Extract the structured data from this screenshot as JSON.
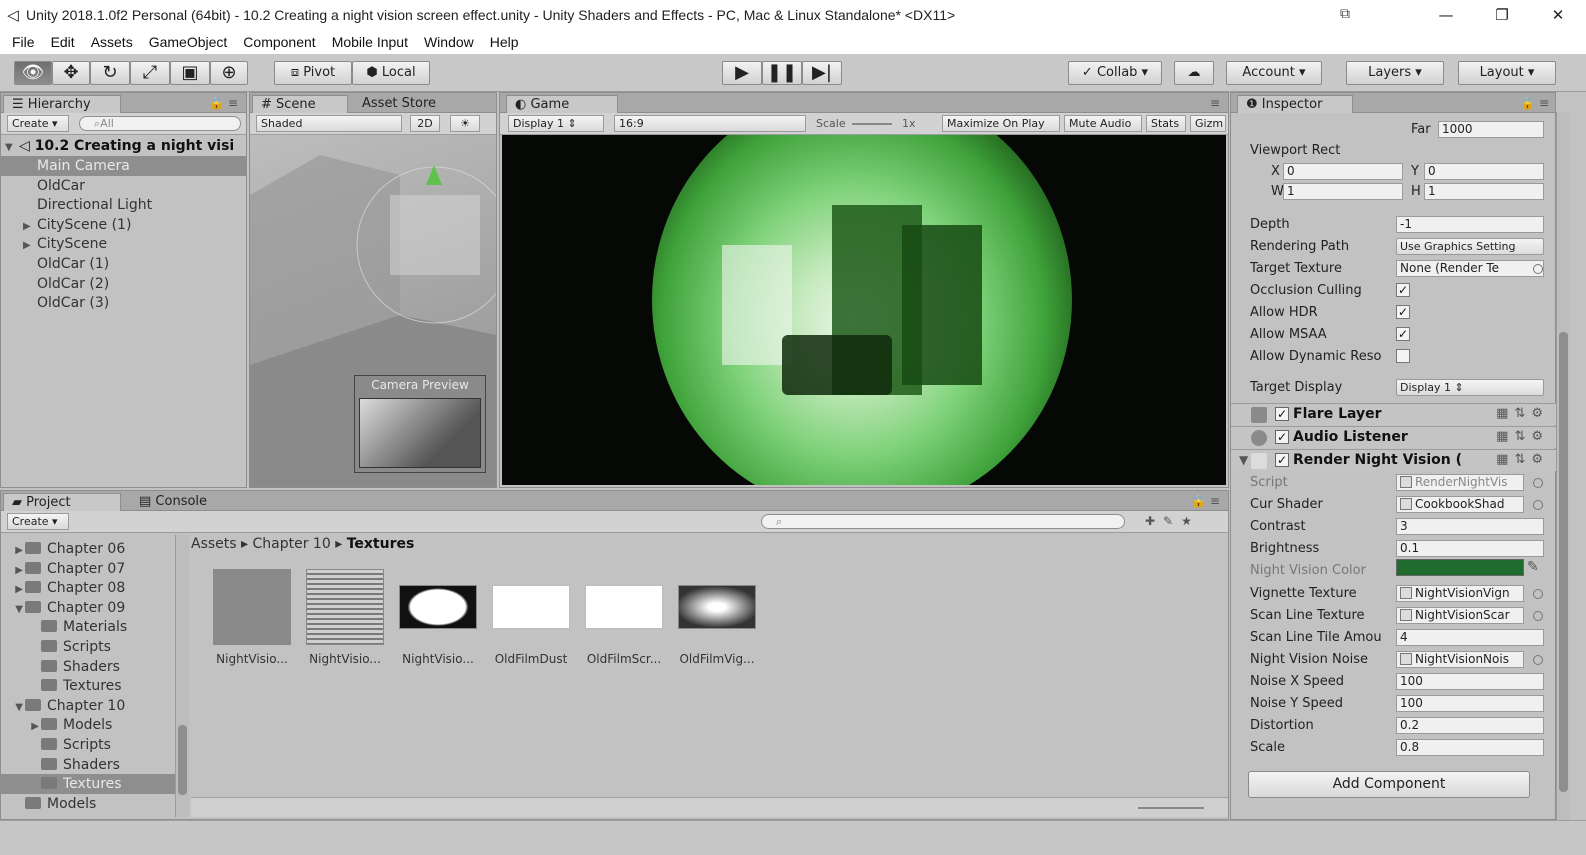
{
  "window": {
    "title": "Unity 2018.1.0f2 Personal (64bit) - 10.2 Creating a night vision screen effect.unity - Unity Shaders and Effects - PC, Mac & Linux Standalone* <DX11>",
    "minimize": "—",
    "maximize": "❐",
    "close": "✕"
  },
  "menu": [
    "File",
    "Edit",
    "Assets",
    "GameObject",
    "Component",
    "Mobile Input",
    "Window",
    "Help"
  ],
  "toolbar": {
    "pivot": "Pivot",
    "local": "Local",
    "collab": "Collab",
    "account": "Account",
    "layers": "Layers",
    "layout": "Layout"
  },
  "hierarchy": {
    "tab": "Hierarchy",
    "create": "Create",
    "search_placeholder": "All",
    "scene_root": "10.2 Creating a night visi",
    "items": [
      {
        "label": "Main Camera",
        "selected": true,
        "expandable": false
      },
      {
        "label": "OldCar",
        "selected": false,
        "expandable": false
      },
      {
        "label": "Directional Light",
        "selected": false,
        "expandable": false
      },
      {
        "label": "CityScene (1)",
        "selected": false,
        "expandable": true
      },
      {
        "label": "CityScene",
        "selected": false,
        "expandable": true
      },
      {
        "label": "OldCar (1)",
        "selected": false,
        "expandable": false
      },
      {
        "label": "OldCar (2)",
        "selected": false,
        "expandable": false
      },
      {
        "label": "OldCar (3)",
        "selected": false,
        "expandable": false
      }
    ]
  },
  "scene": {
    "tab": "Scene",
    "tab2": "Asset Store",
    "shading": "Shaded",
    "mode2d": "2D",
    "camera_preview": "Camera Preview"
  },
  "game": {
    "tab": "Game",
    "display": "Display 1",
    "aspect": "16:9",
    "scale_label": "Scale",
    "scale_value": "1x",
    "maximize": "Maximize On Play",
    "mute": "Mute Audio",
    "stats": "Stats",
    "gizmos": "Gizm"
  },
  "inspector": {
    "tab": "Inspector",
    "far_label": "Far",
    "far_value": "1000",
    "viewport_rect": "Viewport Rect",
    "x_label": "X",
    "x_value": "0",
    "y_label": "Y",
    "y_value": "0",
    "w_label": "W",
    "w_value": "1",
    "h_label": "H",
    "h_value": "1",
    "props": [
      {
        "label": "Depth",
        "value": "-1",
        "kind": "field"
      },
      {
        "label": "Rendering Path",
        "value": "Use Graphics Setting",
        "kind": "dropdown"
      },
      {
        "label": "Target Texture",
        "value": "None (Render Te",
        "kind": "object"
      },
      {
        "label": "Occlusion Culling",
        "value": "✓",
        "kind": "check"
      },
      {
        "label": "Allow HDR",
        "value": "✓",
        "kind": "check"
      },
      {
        "label": "Allow MSAA",
        "value": "✓",
        "kind": "check"
      },
      {
        "label": "Allow Dynamic Reso",
        "value": "",
        "kind": "check"
      }
    ],
    "target_display_label": "Target Display",
    "target_display_value": "Display 1",
    "flare_layer": "Flare Layer",
    "audio_listener": "Audio Listener",
    "render_night_vision": "Render Night Vision (",
    "nv_props": [
      {
        "label": "Script",
        "value": "RenderNightVis",
        "dim": true
      },
      {
        "label": "Cur Shader",
        "value": "CookbookShad",
        "dim": false
      },
      {
        "label": "Contrast",
        "value": "3",
        "dim": false
      },
      {
        "label": "Brightness",
        "value": "0.1",
        "dim": false
      },
      {
        "label": "Night Vision Color",
        "value": "",
        "dim": true
      },
      {
        "label": "Vignette Texture",
        "value": "NightVisionVign",
        "dim": false
      },
      {
        "label": "Scan Line Texture",
        "value": "NightVisionScar",
        "dim": false
      },
      {
        "label": "Scan Line Tile Amou",
        "value": "4",
        "dim": false
      },
      {
        "label": "Night Vision Noise",
        "value": "NightVisionNois",
        "dim": false
      },
      {
        "label": "Noise X Speed",
        "value": "100",
        "dim": false
      },
      {
        "label": "Noise Y Speed",
        "value": "100",
        "dim": false
      },
      {
        "label": "Distortion",
        "value": "0.2",
        "dim": false
      },
      {
        "label": "Scale",
        "value": "0.8",
        "dim": false
      }
    ],
    "night_vision_color": "#1f6a2d",
    "add_component": "Add Component"
  },
  "project": {
    "tab": "Project",
    "tab2": "Console",
    "create": "Create",
    "tree": [
      {
        "label": "Chapter 06",
        "indent": 1,
        "arrow": "▶",
        "selected": false
      },
      {
        "label": "Chapter 07",
        "indent": 1,
        "arrow": "▶",
        "selected": false
      },
      {
        "label": "Chapter 08",
        "indent": 1,
        "arrow": "▶",
        "selected": false
      },
      {
        "label": "Chapter 09",
        "indent": 1,
        "arrow": "▼",
        "selected": false
      },
      {
        "label": "Materials",
        "indent": 2,
        "arrow": "",
        "selected": false
      },
      {
        "label": "Scripts",
        "indent": 2,
        "arrow": "",
        "selected": false
      },
      {
        "label": "Shaders",
        "indent": 2,
        "arrow": "",
        "selected": false
      },
      {
        "label": "Textures",
        "indent": 2,
        "arrow": "",
        "selected": false
      },
      {
        "label": "Chapter 10",
        "indent": 1,
        "arrow": "▼",
        "selected": false
      },
      {
        "label": "Models",
        "indent": 2,
        "arrow": "▶",
        "selected": false
      },
      {
        "label": "Scripts",
        "indent": 2,
        "arrow": "",
        "selected": false
      },
      {
        "label": "Shaders",
        "indent": 2,
        "arrow": "",
        "selected": false
      },
      {
        "label": "Textures",
        "indent": 2,
        "arrow": "",
        "selected": true
      },
      {
        "label": "Models",
        "indent": 1,
        "arrow": "",
        "selected": false
      }
    ],
    "breadcrumb": [
      "Assets",
      "Chapter 10",
      "Textures"
    ],
    "assets": [
      {
        "name": "NightVisio...",
        "thumb": "gray"
      },
      {
        "name": "NightVisio...",
        "thumb": "lines"
      },
      {
        "name": "NightVisio...",
        "thumb": "vignette"
      },
      {
        "name": "OldFilmDust",
        "thumb": "white"
      },
      {
        "name": "OldFilmScr...",
        "thumb": "white"
      },
      {
        "name": "OldFilmVig...",
        "thumb": "oldvig"
      }
    ]
  }
}
